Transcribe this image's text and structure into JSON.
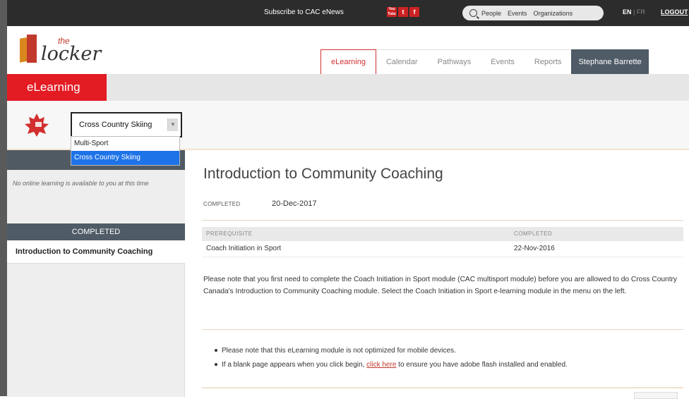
{
  "topbar": {
    "subscribe": "Subscribe to CAC eNews",
    "social": [
      "You Tube",
      "t",
      "f"
    ],
    "search_items": [
      "People",
      "Events",
      "Organizations"
    ],
    "lang_en": "EN",
    "lang_sep": "|",
    "lang_fr": "FR",
    "logout": "LOGOUT"
  },
  "logo": {
    "the": "the",
    "word": "locker"
  },
  "nav": {
    "tabs": [
      "eLearning",
      "Calendar",
      "Pathways",
      "Events",
      "Reports"
    ],
    "active": "eLearning",
    "user": "Stephane Barrette"
  },
  "section": {
    "title": "eLearning"
  },
  "sport_select": {
    "value": "Cross Country Skiing",
    "options": [
      "Multi-Sport",
      "Cross Country Skiing"
    ],
    "selected_index": 1
  },
  "sidebar": {
    "notice": "No online learning is available to you at this time",
    "completed_header": "COMPLETED",
    "completed_items": [
      "Introduction to Community Coaching"
    ]
  },
  "main": {
    "title": "Introduction to Community Coaching",
    "completed_label": "COMPLETED",
    "completed_date": "20-Dec-2017",
    "table": {
      "headers": [
        "PREREQUISITE",
        "COMPLETED"
      ],
      "rows": [
        [
          "Coach Initiation in Sport",
          "22-Nov-2016"
        ]
      ]
    },
    "note": "Please note that you first need to complete the Coach Initiation in Sport module (CAC multisport module) before you are allowed to do Cross Country Canada's Introduction to Community Coaching module. Select the Coach Initiation in Sport e-learning module in the menu on the left.",
    "bullet1": "Please note that this eLearning module is not optimized for mobile devices.",
    "bullet2_pre": "If a blank page appears when you click begin,",
    "bullet2_link": "click here",
    "bullet2_post": "to ensure you have adobe flash installed and enabled."
  },
  "colors": {
    "brand_red": "#e31b23",
    "dark_slate": "#4f5b66",
    "select_blue": "#1e73e8"
  }
}
